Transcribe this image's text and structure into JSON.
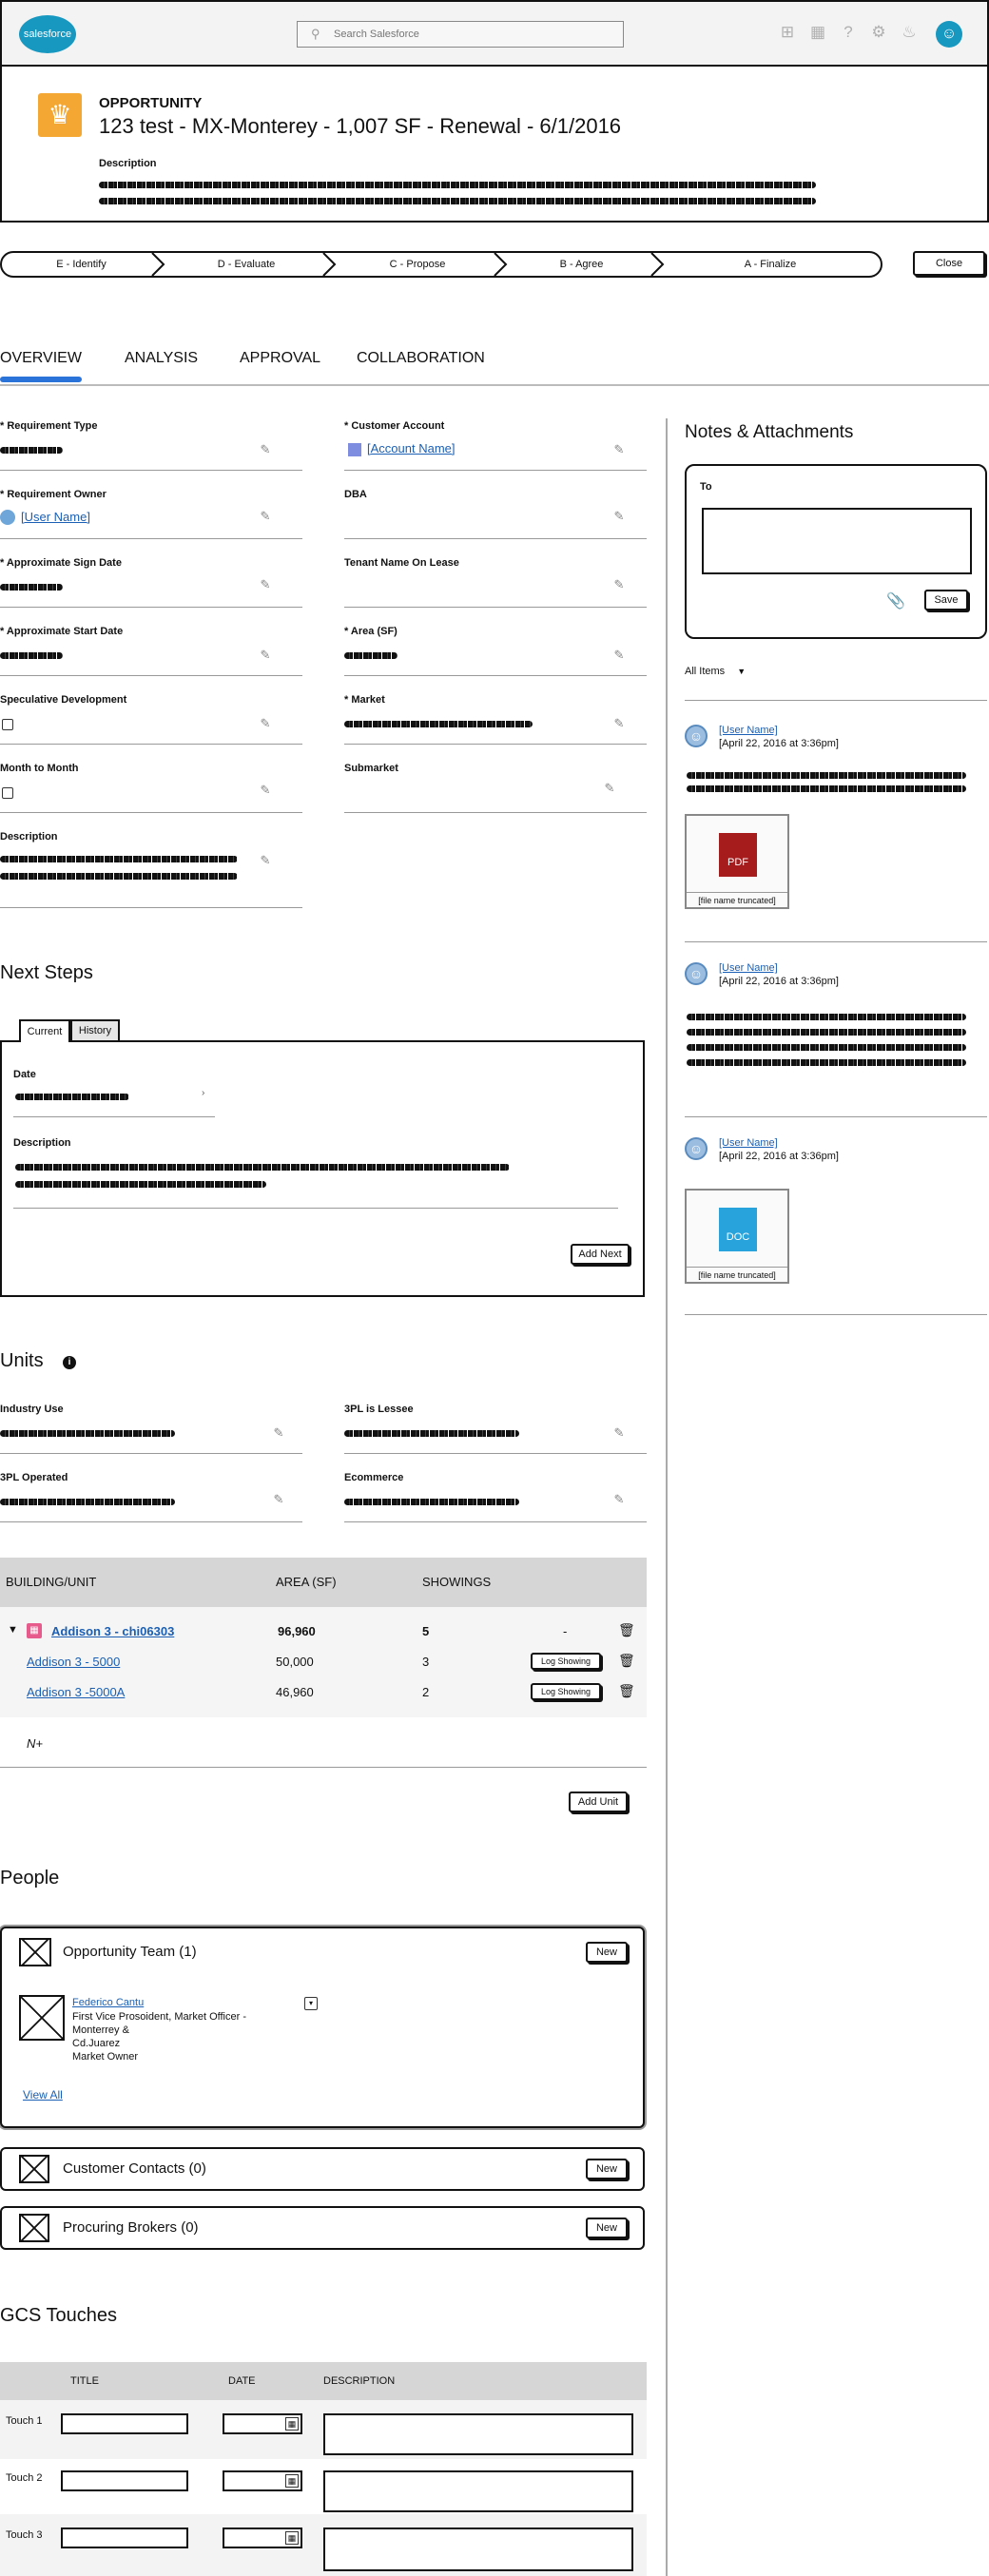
{
  "header": {
    "logo_text": "salesforce",
    "search_placeholder": "Search Salesforce",
    "icons": [
      "plus-icon",
      "apps-grid-icon",
      "help-icon",
      "setup-gear-icon",
      "bell-icon",
      "avatar-icon"
    ]
  },
  "record": {
    "object_type": "OPPORTUNITY",
    "title": "123 test - MX-Monterey - 1,007 SF - Renewal - 6/1/2016",
    "description_label": "Description"
  },
  "path": {
    "stages": [
      "E - Identify",
      "D - Evaluate",
      "C - Propose",
      "B - Agree",
      "A - Finalize"
    ],
    "close_label": "Close"
  },
  "tabs": [
    "OVERVIEW",
    "ANALYSIS",
    "APPROVAL",
    "COLLABORATION"
  ],
  "overview": {
    "left_fields": [
      {
        "label": "* Requirement Type",
        "value": ""
      },
      {
        "label": "* Requirement Owner",
        "value": "[User Name]"
      },
      {
        "label": "* Approximate Sign Date",
        "value": ""
      },
      {
        "label": "* Approximate Start Date",
        "value": ""
      },
      {
        "label": "Speculative Development",
        "value": ""
      },
      {
        "label": "Month to Month",
        "value": ""
      },
      {
        "label": "Description",
        "value": ""
      }
    ],
    "right_fields": [
      {
        "label": "* Customer Account",
        "value": "[Account Name]"
      },
      {
        "label": "DBA",
        "value": ""
      },
      {
        "label": "Tenant Name On Lease",
        "value": ""
      },
      {
        "label": "* Area (SF)",
        "value": ""
      },
      {
        "label": "* Market",
        "value": ""
      },
      {
        "label": "Submarket",
        "value": ""
      }
    ]
  },
  "next_steps": {
    "title": "Next Steps",
    "tabs": [
      "Current",
      "History"
    ],
    "date_label": "Date",
    "description_label": "Description",
    "add_next_label": "Add Next"
  },
  "units": {
    "title": "Units",
    "fields": [
      {
        "label": "Industry Use"
      },
      {
        "label": "3PL is Lessee"
      },
      {
        "label": "3PL Operated"
      },
      {
        "label": "Ecommerce"
      }
    ],
    "columns": [
      "BUILDING/UNIT",
      "AREA (SF)",
      "SHOWINGS"
    ],
    "rows": [
      {
        "name": "Addison 3 - chi06303",
        "area": "96,960",
        "showings": "5",
        "action": "-"
      },
      {
        "name": "Addison 3 - 5000",
        "area": "50,000",
        "showings": "3",
        "action": "Log Showing"
      },
      {
        "name": "Addison 3 -5000A",
        "area": "46,960",
        "showings": "2",
        "action": "Log Showing"
      }
    ],
    "new_row_label": "N+",
    "add_unit_label": "Add Unit"
  },
  "people": {
    "title": "People",
    "team": {
      "title": "Opportunity Team (1)",
      "new_label": "New",
      "member_name": "Federico Cantu",
      "member_lines": [
        "First Vice Prosoident, Market Officer -",
        "Monterrey &",
        "Cd.Juarez",
        "Market Owner"
      ],
      "view_all": "View All"
    },
    "contacts": {
      "title": "Customer Contacts (0)",
      "new_label": "New"
    },
    "brokers": {
      "title": "Procuring Brokers (0)",
      "new_label": "New"
    }
  },
  "gcs": {
    "title": "GCS Touches",
    "columns": [
      "TITLE",
      "DATE",
      "DESCRIPTION"
    ],
    "rows": [
      "Touch 1",
      "Touch 2",
      "Touch 3"
    ]
  },
  "notes": {
    "title": "Notes & Attachments",
    "to_label": "To",
    "save_label": "Save",
    "filter_label": "All Items",
    "entries": [
      {
        "user": "[User Name]",
        "date": "[April 22, 2016 at 3:36pm]",
        "file_type": "PDF",
        "file_name": "[file name truncated]"
      },
      {
        "user": "[User Name]",
        "date": "[April 22, 2016 at 3:36pm]"
      },
      {
        "user": "[User Name]",
        "date": "[April 22, 2016 at 3:36pm]",
        "file_type": "DOC",
        "file_name": "[file name truncated]"
      }
    ]
  },
  "colors": {
    "brand_blue": "#1798c1",
    "accent_orange": "#f4a732",
    "tab_underline": "#2a73d9",
    "pdf_red": "#a61c1c",
    "doc_blue": "#29a3dc"
  }
}
